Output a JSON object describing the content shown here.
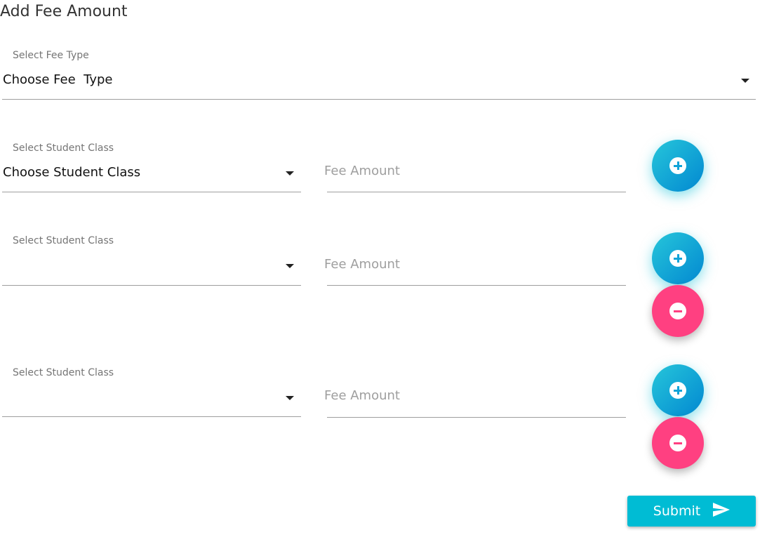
{
  "page": {
    "title": "Add Fee Amount"
  },
  "fee_type": {
    "label": "Select Fee Type",
    "value": "Choose Fee  Type"
  },
  "rows": [
    {
      "class_label": "Select Student Class",
      "class_value": "Choose Student Class",
      "amount_placeholder": "Fee Amount",
      "add_icon": "add-circle-icon"
    },
    {
      "class_label": "Select Student Class",
      "class_value": "",
      "amount_placeholder": "Fee Amount",
      "add_icon": "add-circle-icon",
      "remove_icon": "remove-circle-icon"
    },
    {
      "class_label": "Select Student Class",
      "class_value": "",
      "amount_placeholder": "Fee Amount",
      "add_icon": "add-circle-icon",
      "remove_icon": "remove-circle-icon"
    }
  ],
  "submit": {
    "label": "Submit",
    "icon": "send-icon"
  },
  "colors": {
    "accent": "#00bcd4",
    "add_gradient_start": "#26c6da",
    "add_gradient_end": "#0288d1",
    "remove": "#ff4081"
  }
}
